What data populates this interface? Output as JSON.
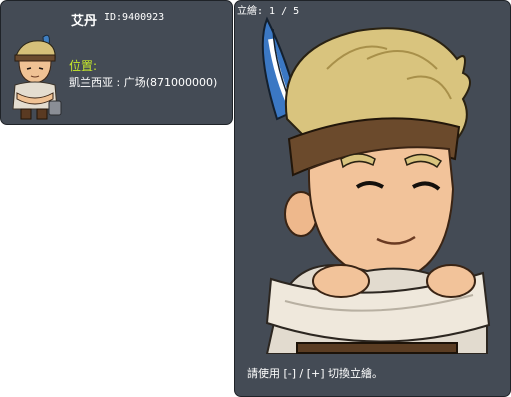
{
  "npc": {
    "name": "艾丹",
    "id_text": "ID:9400923",
    "location_label": "位置:",
    "location_value": "凱兰西亚 : 广场(871000000)"
  },
  "illustration": {
    "counter": "立繪: 1 / 5",
    "hint": "請使用 [-] / [+] 切換立繪。"
  },
  "colors": {
    "panel_bg": "#444b55",
    "location_label": "#c6e82a",
    "text": "#ffffff"
  }
}
